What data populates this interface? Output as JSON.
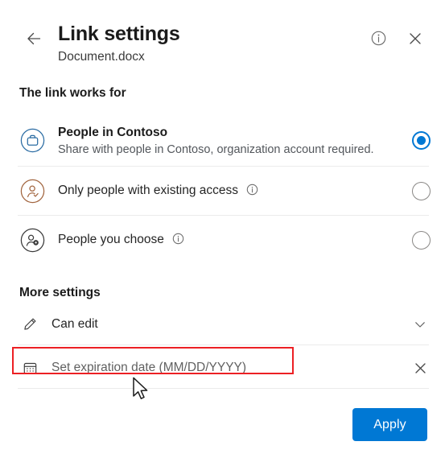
{
  "header": {
    "back_icon": "arrow-left-icon",
    "title": "Link settings",
    "subtitle": "Document.docx",
    "info_icon": "info-circle-icon",
    "close_icon": "close-icon"
  },
  "works_for": {
    "heading": "The link works for",
    "options": [
      {
        "icon": "briefcase-circle-icon",
        "label": "People in Contoso",
        "description": "Share with people in Contoso, organization account required.",
        "has_info": false,
        "selected": true,
        "radio_name": "radio-people-in-contoso"
      },
      {
        "icon": "person-check-circle-icon",
        "label": "Only people with existing access",
        "description": "",
        "has_info": true,
        "info_icon": "info-circle-icon",
        "selected": false,
        "radio_name": "radio-existing-access"
      },
      {
        "icon": "person-settings-circle-icon",
        "label": "People you choose",
        "description": "",
        "has_info": true,
        "info_icon": "info-circle-icon",
        "selected": false,
        "radio_name": "radio-people-you-choose"
      }
    ]
  },
  "more_settings": {
    "heading": "More settings",
    "permission_row": {
      "icon": "pencil-icon",
      "label": "Can edit",
      "trailing_icon": "chevron-down-icon"
    },
    "expiration_row": {
      "icon": "calendar-icon",
      "placeholder": "Set expiration date (MM/DD/YYYY)",
      "value": "",
      "trailing_icon": "close-icon"
    }
  },
  "footer": {
    "apply_label": "Apply"
  },
  "colors": {
    "accent": "#0078d4",
    "highlight_box": "#ec2024",
    "briefcase_icon": "#2b6ca3",
    "person_check_icon": "#a2653f",
    "person_settings_icon": "#3b3b3b",
    "divider": "#ebebeb"
  }
}
